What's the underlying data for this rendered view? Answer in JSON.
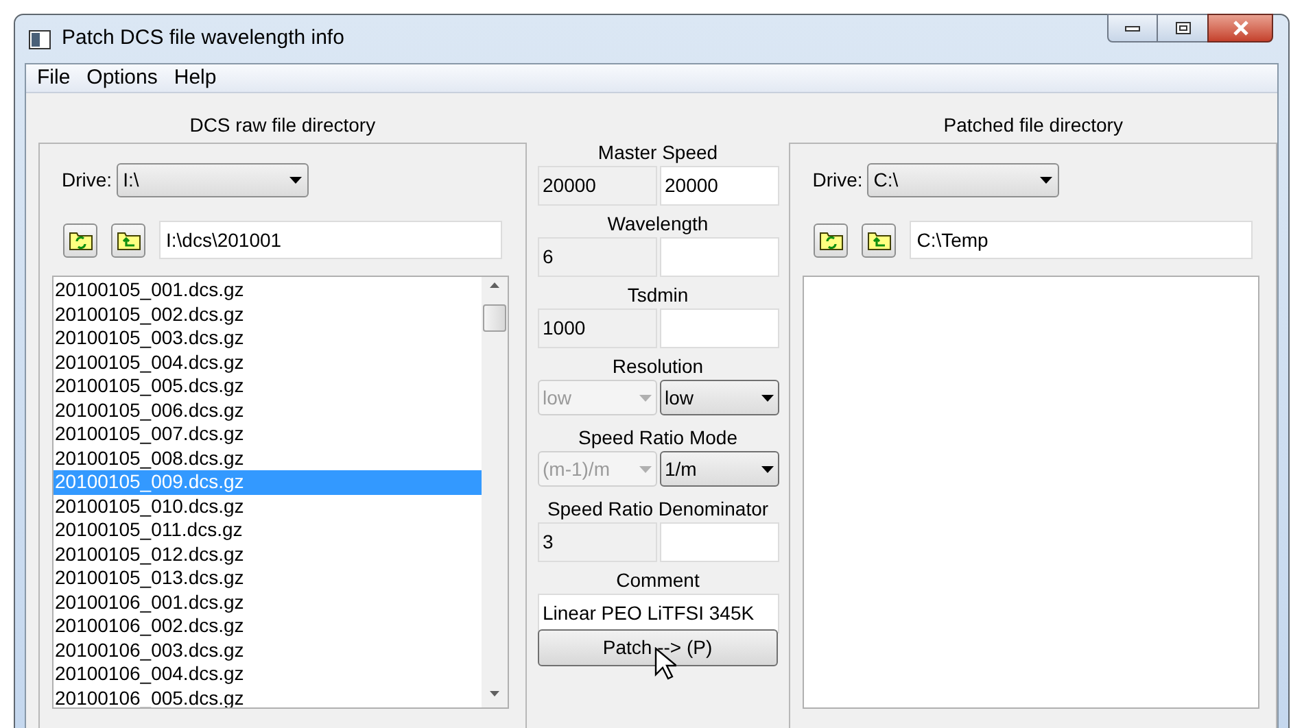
{
  "window": {
    "title": "Patch DCS file wavelength info"
  },
  "menu": [
    "File",
    "Options",
    "Help"
  ],
  "source": {
    "title": "DCS raw file directory",
    "drive_label": "Drive:",
    "drive": "I:\\",
    "path": "I:\\dcs\\201001",
    "files": [
      {
        "name": "20100105_001.dcs.gz",
        "selected": false
      },
      {
        "name": "20100105_002.dcs.gz",
        "selected": false
      },
      {
        "name": "20100105_003.dcs.gz",
        "selected": false
      },
      {
        "name": "20100105_004.dcs.gz",
        "selected": false
      },
      {
        "name": "20100105_005.dcs.gz",
        "selected": false
      },
      {
        "name": "20100105_006.dcs.gz",
        "selected": false
      },
      {
        "name": "20100105_007.dcs.gz",
        "selected": false
      },
      {
        "name": "20100105_008.dcs.gz",
        "selected": false
      },
      {
        "name": "20100105_009.dcs.gz",
        "selected": true
      },
      {
        "name": "20100105_010.dcs.gz",
        "selected": false
      },
      {
        "name": "20100105_011.dcs.gz",
        "selected": false
      },
      {
        "name": "20100105_012.dcs.gz",
        "selected": false
      },
      {
        "name": "20100105_013.dcs.gz",
        "selected": false
      },
      {
        "name": "20100106_001.dcs.gz",
        "selected": false
      },
      {
        "name": "20100106_002.dcs.gz",
        "selected": false
      },
      {
        "name": "20100106_003.dcs.gz",
        "selected": false
      },
      {
        "name": "20100106_004.dcs.gz",
        "selected": false
      },
      {
        "name": "20100106_005.dcs.gz",
        "selected": false
      }
    ]
  },
  "fields": [
    {
      "label": "Master Speed",
      "kind": "pair",
      "current": "20000",
      "new": "20000"
    },
    {
      "label": "Wavelength",
      "kind": "pair",
      "current": "6"
    },
    {
      "label": "Tsdmin",
      "kind": "pair",
      "current": "1000"
    },
    {
      "label": "Resolution",
      "kind": "select",
      "current": "low",
      "new": "low"
    },
    {
      "label": "Speed Ratio Mode",
      "kind": "select",
      "current": "(m-1)/m",
      "new": "1/m"
    },
    {
      "label": "Speed Ratio Denominator",
      "kind": "pair",
      "current": "3"
    },
    {
      "label": "Comment",
      "kind": "single",
      "new": "Linear PEO LiTFSI 345K"
    }
  ],
  "patch_button": "Patch --> (P)",
  "target": {
    "title": "Patched file directory",
    "drive_label": "Drive:",
    "drive": "C:\\",
    "path": "C:\\Temp"
  }
}
